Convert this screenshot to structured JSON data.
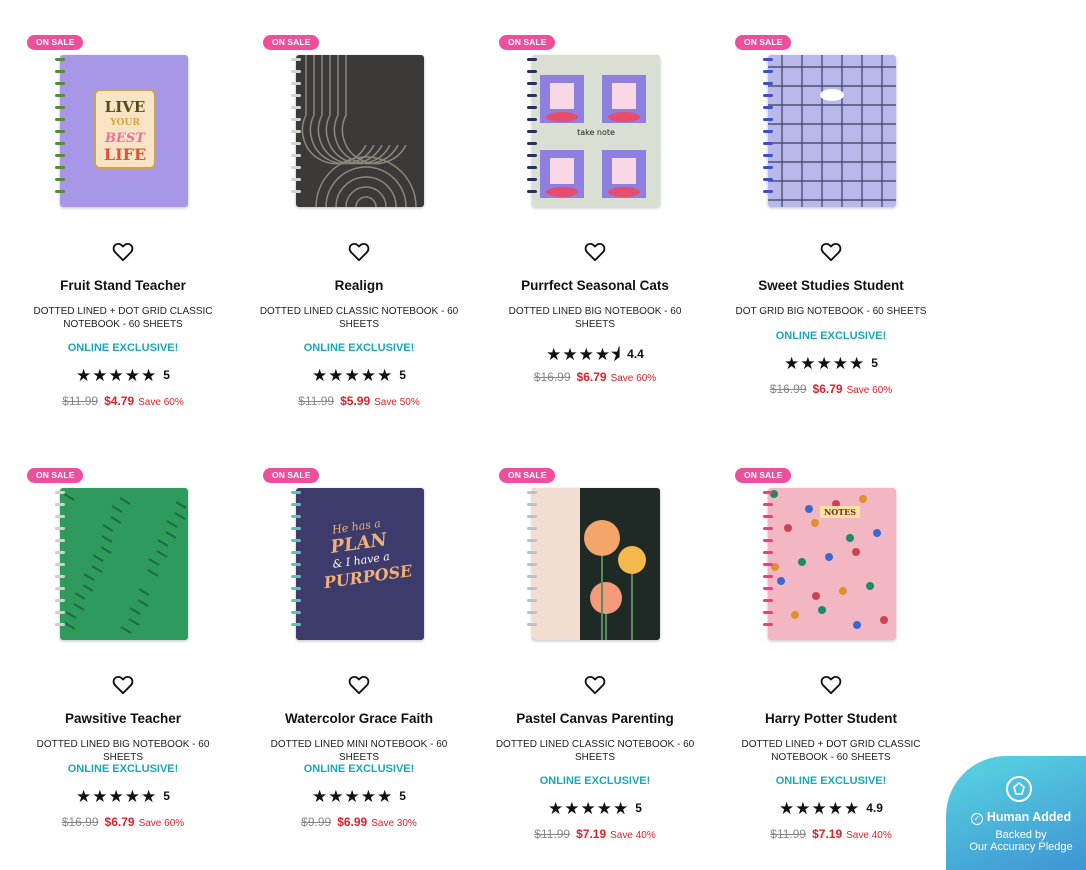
{
  "badge_label": "ON SALE",
  "excl_label": "ONLINE EXCLUSIVE!",
  "save_prefix": "Save",
  "products": [
    {
      "name": "Fruit Stand Teacher",
      "desc": "DOTTED LINED + DOT GRID CLASSIC NOTEBOOK - 60 SHEETS",
      "exclusive": true,
      "stars": "★★★★★",
      "rating": "5",
      "old_price": "$11.99",
      "new_price": "$4.79",
      "save": "Save 60%",
      "cover_color": "#a897e6"
    },
    {
      "name": "Realign",
      "desc": "DOTTED LINED CLASSIC NOTEBOOK - 60 SHEETS",
      "exclusive": true,
      "stars": "★★★★★",
      "rating": "5",
      "old_price": "$11.99",
      "new_price": "$5.99",
      "save": "Save 50%",
      "cover_color": "#3b3a38"
    },
    {
      "name": "Purrfect Seasonal Cats",
      "desc": "DOTTED LINED BIG NOTEBOOK - 60 SHEETS",
      "exclusive": false,
      "stars": "★★★★⯨",
      "rating": "4.4",
      "old_price": "$16.99",
      "new_price": "$6.79",
      "save": "Save 60%",
      "cover_color": "#d9dfd3"
    },
    {
      "name": "Sweet Studies Student",
      "desc": "DOT GRID BIG NOTEBOOK - 60 SHEETS",
      "exclusive": true,
      "stars": "★★★★★",
      "rating": "5",
      "old_price": "$16.99",
      "new_price": "$6.79",
      "save": "Save 60%",
      "cover_color": "#b8b9ea"
    },
    {
      "name": "Pawsitive Teacher",
      "desc": "DOTTED LINED BIG NOTEBOOK - 60 SHEETS",
      "exclusive": true,
      "stars": "★★★★★",
      "rating": "5",
      "old_price": "$16.99",
      "new_price": "$6.79",
      "save": "Save 60%",
      "cover_color": "#2e9a5c"
    },
    {
      "name": "Watercolor Grace Faith",
      "desc": "DOTTED LINED MINI NOTEBOOK - 60 SHEETS",
      "exclusive": true,
      "stars": "★★★★★",
      "rating": "5",
      "old_price": "$9.99",
      "new_price": "$6.99",
      "save": "Save 30%",
      "cover_color": "#3c3b6b"
    },
    {
      "name": "Pastel Canvas Parenting",
      "desc": "DOTTED LINED CLASSIC NOTEBOOK - 60 SHEETS",
      "exclusive": true,
      "stars": "★★★★★",
      "rating": "5",
      "old_price": "$11.99",
      "new_price": "$7.19",
      "save": "Save 40%",
      "cover_color": "#1f2a26"
    },
    {
      "name": "Harry Potter Student",
      "desc": "DOTTED LINED + DOT GRID CLASSIC NOTEBOOK - 60 SHEETS",
      "exclusive": true,
      "stars": "★★★★★",
      "rating": "4.9",
      "old_price": "$11.99",
      "new_price": "$7.19",
      "save": "Save 40%",
      "cover_color": "#f3b7c4"
    }
  ],
  "cover_text": {
    "live": "LIVE",
    "your": "YOUR",
    "best": "BEST",
    "life": "LIFE",
    "plan_line1": "He has a",
    "plan_line2": "PLAN",
    "plan_line3": "& I have a",
    "plan_line4": "PURPOSE",
    "notes": "NOTES",
    "take_note": "take note"
  },
  "pledge": {
    "title": "Human Added",
    "line1": "Backed by",
    "line2": "Our Accuracy Pledge"
  }
}
